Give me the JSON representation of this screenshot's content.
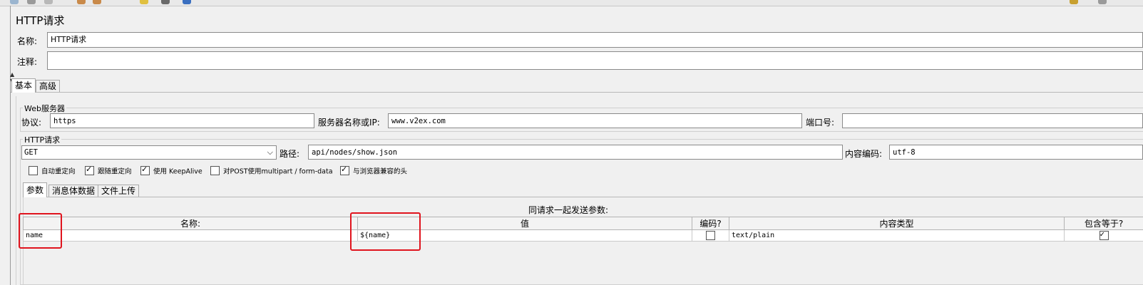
{
  "title": "HTTP请求",
  "name_label": "名称:",
  "name_value": "HTTP请求",
  "comment_label": "注释:",
  "comment_value": "",
  "tabs": [
    {
      "label": "基本"
    },
    {
      "label": "高级"
    }
  ],
  "web_server": {
    "group_title": "Web服务器",
    "protocol_label": "协议:",
    "protocol_value": "https",
    "server_label": "服务器名称或IP:",
    "server_value": "www.v2ex.com",
    "port_label": "端口号:",
    "port_value": ""
  },
  "http_request": {
    "group_title": "HTTP请求",
    "method": "GET",
    "path_label": "路径:",
    "path_value": "api/nodes/show.json",
    "encoding_label": "内容编码:",
    "encoding_value": "utf-8"
  },
  "options": [
    {
      "label": "自动重定向",
      "checked": false
    },
    {
      "label": "跟随重定向",
      "checked": true
    },
    {
      "label": "使用 KeepAlive",
      "checked": true
    },
    {
      "label": "对POST使用multipart / form-data",
      "checked": false
    },
    {
      "label": "与浏览器兼容的头",
      "checked": true
    }
  ],
  "param_tabs": [
    {
      "label": "参数"
    },
    {
      "label": "消息体数据"
    },
    {
      "label": "文件上传"
    }
  ],
  "params_caption": "同请求一起发送参数:",
  "params_table": {
    "columns": [
      "名称:",
      "值",
      "编码?",
      "内容类型",
      "包含等于?"
    ],
    "rows": [
      {
        "name": "name",
        "value": "${name}",
        "encode": false,
        "content_type": "text/plain",
        "include_equals": true
      }
    ]
  }
}
